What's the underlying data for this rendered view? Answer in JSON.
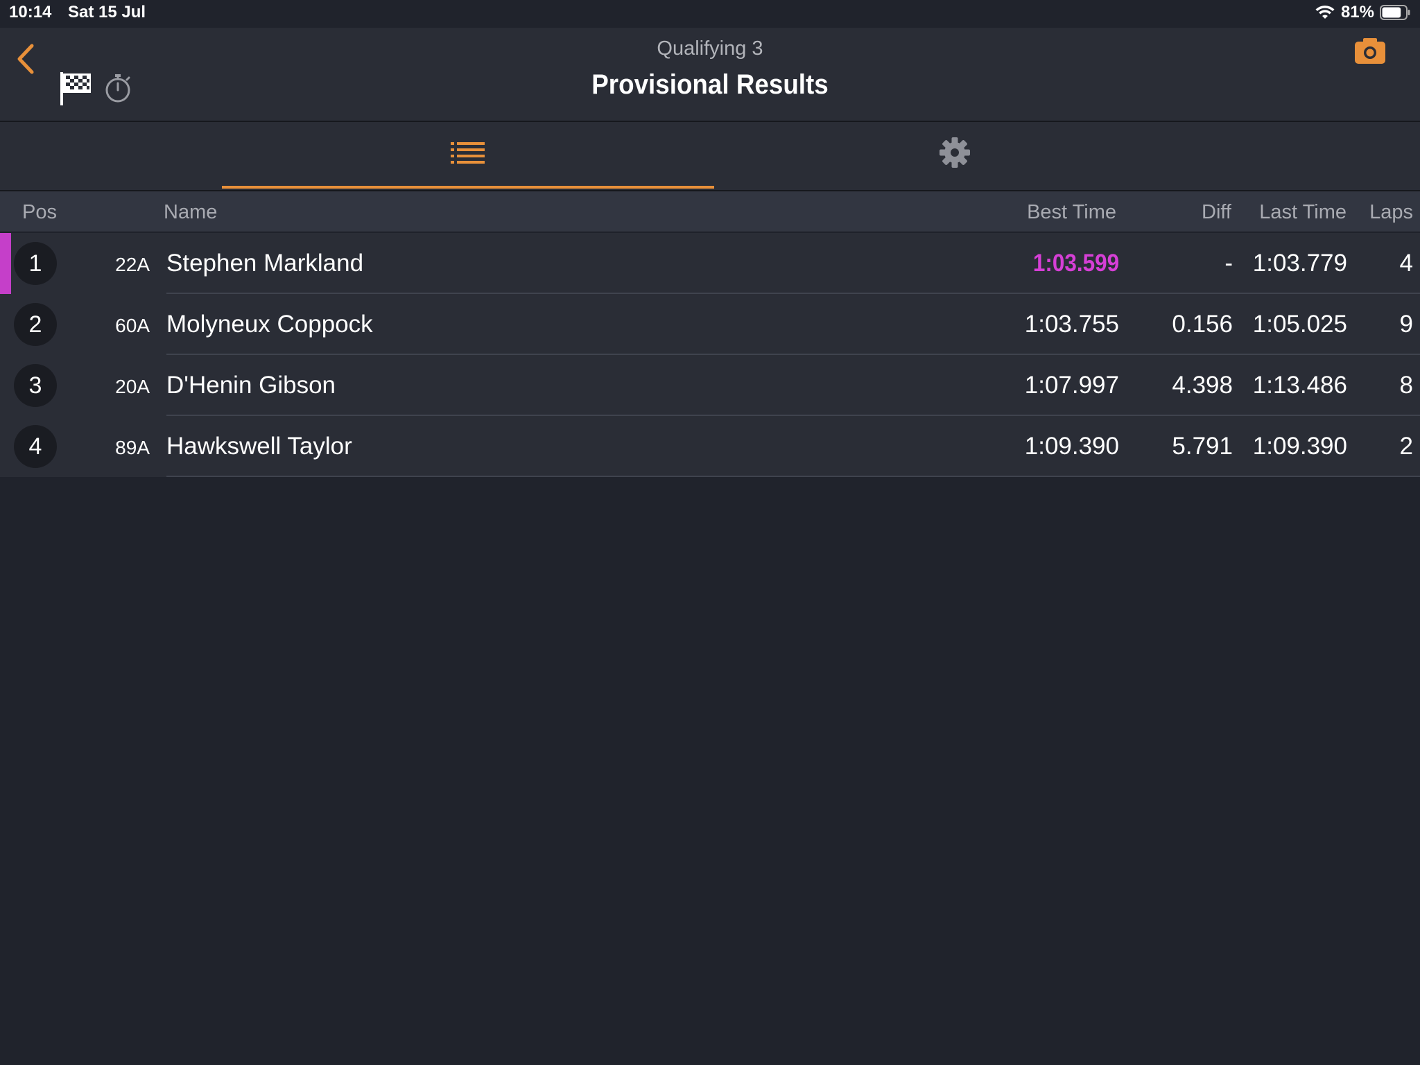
{
  "status_bar": {
    "time": "10:14",
    "date": "Sat 15 Jul",
    "battery": "81%",
    "battery_level": 0.81
  },
  "header": {
    "subtitle": "Qualifying 3",
    "title": "Provisional Results",
    "accent_color": "#e8903a",
    "icons": [
      "back-icon",
      "checkered-flag-icon",
      "stopwatch-icon",
      "camera-icon"
    ]
  },
  "tabs": [
    {
      "icon": "list-icon",
      "active": true
    },
    {
      "icon": "gear-icon",
      "active": false
    }
  ],
  "table": {
    "columns": {
      "pos": "Pos",
      "name": "Name",
      "best_time": "Best Time",
      "diff": "Diff",
      "last_time": "Last Time",
      "laps": "Laps"
    },
    "rows": [
      {
        "pos": "1",
        "car": "22A",
        "name": "Stephen Markland",
        "best": "1:03.599",
        "diff": "-",
        "last": "1:03.779",
        "laps": "4",
        "fastest": true
      },
      {
        "pos": "2",
        "car": "60A",
        "name": "Molyneux Coppock",
        "best": "1:03.755",
        "diff": "0.156",
        "last": "1:05.025",
        "laps": "9",
        "fastest": false
      },
      {
        "pos": "3",
        "car": "20A",
        "name": "D'Henin Gibson",
        "best": "1:07.997",
        "diff": "4.398",
        "last": "1:13.486",
        "laps": "8",
        "fastest": false
      },
      {
        "pos": "4",
        "car": "89A",
        "name": "Hawkswell Taylor",
        "best": "1:09.390",
        "diff": "5.791",
        "last": "1:09.390",
        "laps": "2",
        "fastest": false
      }
    ],
    "fastest_color": "#d63fd6"
  }
}
